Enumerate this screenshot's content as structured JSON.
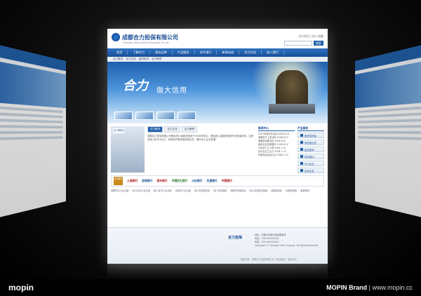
{
  "site": {
    "title_cn": "成都合力担保有限公司",
    "title_en": "Chengdu HeliChuanYe Guarantee Co.,Ltd.",
    "top_links": "设为首页 | 加入收藏",
    "search_button": "搜索"
  },
  "nav": [
    "首页",
    "了解合力",
    "服务品种",
    "产品服务",
    "合作银行",
    "新闻动态",
    "合力文化",
    "加入我们"
  ],
  "crumbs": [
    "合力概况",
    "合力文化",
    "组织机构",
    "合力荣誉"
  ],
  "banner": {
    "mark": "合力",
    "slogan": "做大信用"
  },
  "intro": {
    "badge": "合力概况",
    "tabs": [
      "合力概况",
      "合力文化",
      "合力荣誉"
    ],
    "text": "成都合力担保有限公司是经四川省政府批准于2008年成立，是经四川省政府批准专业担保机构，注册资金人民币1亿元，并积极开展贷款担保业务，服务中小企业发展。"
  },
  "news": {
    "title": "新闻中心",
    "items": [
      "2007年某合作活动 2008-9-01",
      "某融资于上来活动 2008-8-27",
      "某融资讲座活动 2008-8-21",
      "面向企业担保服务 2008-8-12",
      "公司合力之人物 2008-7-21",
      "合作企业之合力 2008-7-13",
      "年度总结活动之合 2008-7-01"
    ]
  },
  "services": {
    "title": "产品服务",
    "items": [
      "融资性担保",
      "再担保业务",
      "投资咨询",
      "财务顾问",
      "中小企业",
      "综合业务"
    ]
  },
  "partners": {
    "label": "合作银行",
    "banks": [
      "上海银行",
      "浙商银行",
      "恒丰银行",
      "中国民生银行",
      "兴业银行",
      "交通银行",
      "中国银行"
    ]
  },
  "links": [
    "成都市中小企业局",
    "四川省中小企业网",
    "四川省中小企业局",
    "中国中小企业网",
    "四川省担保协会",
    "四川省担保网",
    "成都市担保协会",
    "四川省信用担保网",
    "成都高新区",
    "中国担保网",
    "某某商网"
  ],
  "footer": {
    "logo": "合力担保",
    "info": [
      "地址：成都市高新区某某路某号",
      "电话：028-XXXXXXXX",
      "传真：028-XXXXXXXX",
      "Copyright © Chengdu Heli Chuanye. All Rights Reserved"
    ],
    "bottom": "版权所有：成都合力担保有限公司 | 网站建设：某某公司"
  },
  "watermark": {
    "left": "mopin",
    "right_brand": "MOPIN Brand",
    "right_url": "| www.mopin.cc"
  }
}
